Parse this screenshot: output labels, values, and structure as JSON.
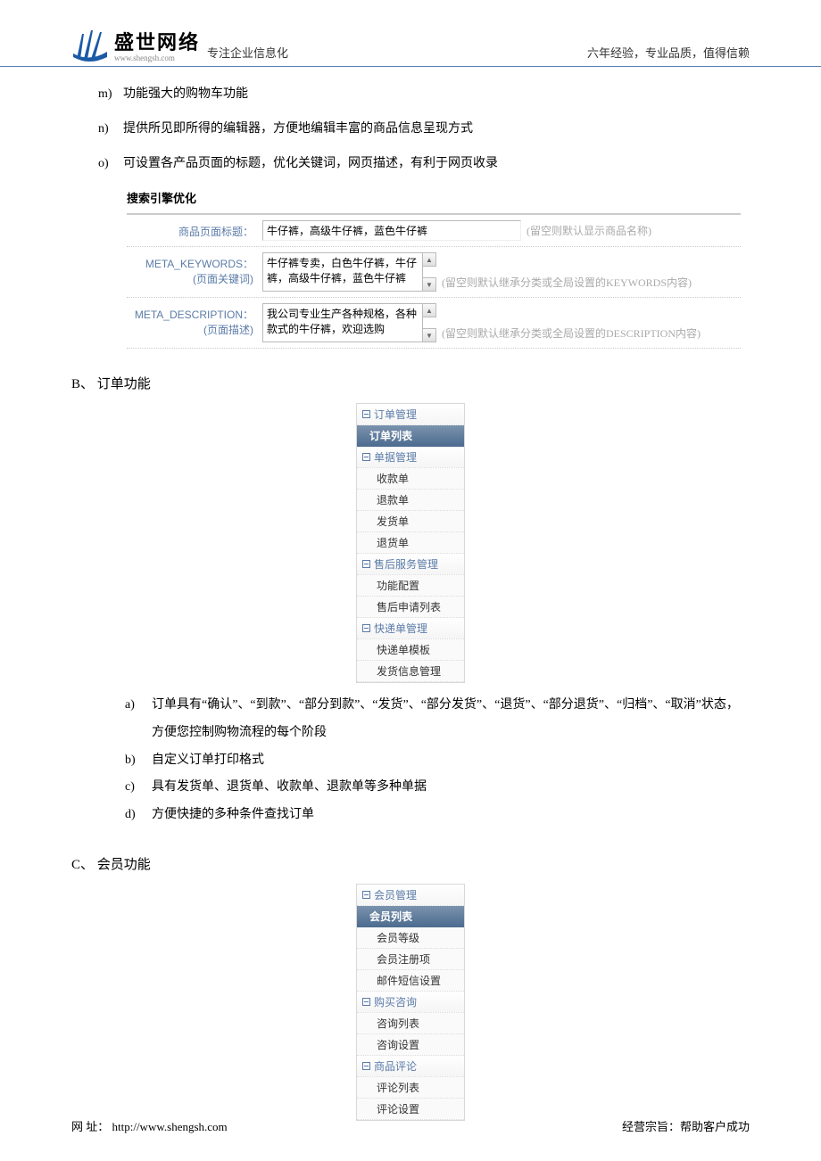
{
  "header": {
    "logo_cn": "盛世网络",
    "logo_url": "www.shengsh.com",
    "tagline_left": "专注企业信息化",
    "tagline_right": "六年经验，专业品质，值得信赖"
  },
  "top_list": [
    {
      "marker": "m)",
      "text": "功能强大的购物车功能"
    },
    {
      "marker": "n)",
      "text": "提供所见即所得的编辑器，方便地编辑丰富的商品信息呈现方式"
    },
    {
      "marker": "o)",
      "text": "可设置各产品页面的标题，优化关键词，网页描述，有利于网页收录"
    }
  ],
  "seo": {
    "title": "搜索引擎优化",
    "rows": [
      {
        "label1": "商品页面标题：",
        "label2": "",
        "type": "input",
        "value": "牛仔裤，高级牛仔裤，蓝色牛仔裤",
        "hint": "(留空则默认显示商品名称)"
      },
      {
        "label1": "META_KEYWORDS：",
        "label2": "(页面关键词)",
        "type": "textarea",
        "value": "牛仔裤专卖，白色牛仔裤，牛仔裤，高级牛仔裤，蓝色牛仔裤",
        "hint": "(留空则默认继承分类或全局设置的KEYWORDS内容)"
      },
      {
        "label1": "META_DESCRIPTION：",
        "label2": "(页面描述)",
        "type": "textarea",
        "value": "我公司专业生产各种规格，各种款式的牛仔裤，欢迎选购",
        "hint": "(留空则默认继承分类或全局设置的DESCRIPTION内容)"
      }
    ]
  },
  "section_b": {
    "heading": "B、 订单功能",
    "menu": [
      {
        "type": "group",
        "label": "订单管理"
      },
      {
        "type": "active",
        "label": "订单列表"
      },
      {
        "type": "group",
        "label": "单据管理"
      },
      {
        "type": "item",
        "label": "收款单"
      },
      {
        "type": "item",
        "label": "退款单"
      },
      {
        "type": "item",
        "label": "发货单"
      },
      {
        "type": "item",
        "label": "退货单"
      },
      {
        "type": "group",
        "label": "售后服务管理"
      },
      {
        "type": "item",
        "label": "功能配置"
      },
      {
        "type": "item",
        "label": "售后申请列表"
      },
      {
        "type": "group",
        "label": "快递单管理"
      },
      {
        "type": "item",
        "label": "快递单模板"
      },
      {
        "type": "item",
        "label": "发货信息管理"
      }
    ],
    "list": [
      {
        "marker": "a)",
        "text": "订单具有“确认”、“到款”、“部分到款”、“发货”、“部分发货”、“退货”、“部分退货”、“归档”、“取消”状态，方便您控制购物流程的每个阶段"
      },
      {
        "marker": "b)",
        "text": "自定义订单打印格式"
      },
      {
        "marker": "c)",
        "text": "具有发货单、退货单、收款单、退款单等多种单据"
      },
      {
        "marker": "d)",
        "text": "方便快捷的多种条件查找订单"
      }
    ]
  },
  "section_c": {
    "heading": "C、 会员功能",
    "menu": [
      {
        "type": "group",
        "label": "会员管理"
      },
      {
        "type": "active",
        "label": "会员列表"
      },
      {
        "type": "item",
        "label": "会员等级"
      },
      {
        "type": "item",
        "label": "会员注册项"
      },
      {
        "type": "item",
        "label": "邮件短信设置"
      },
      {
        "type": "group",
        "label": "购买咨询"
      },
      {
        "type": "item",
        "label": "咨询列表"
      },
      {
        "type": "item",
        "label": "咨询设置"
      },
      {
        "type": "group",
        "label": "商品评论"
      },
      {
        "type": "item",
        "label": "评论列表"
      },
      {
        "type": "item",
        "label": "评论设置"
      }
    ]
  },
  "footer": {
    "left": "网 址： http://www.shengsh.com",
    "right": "经营宗旨：帮助客户成功"
  }
}
